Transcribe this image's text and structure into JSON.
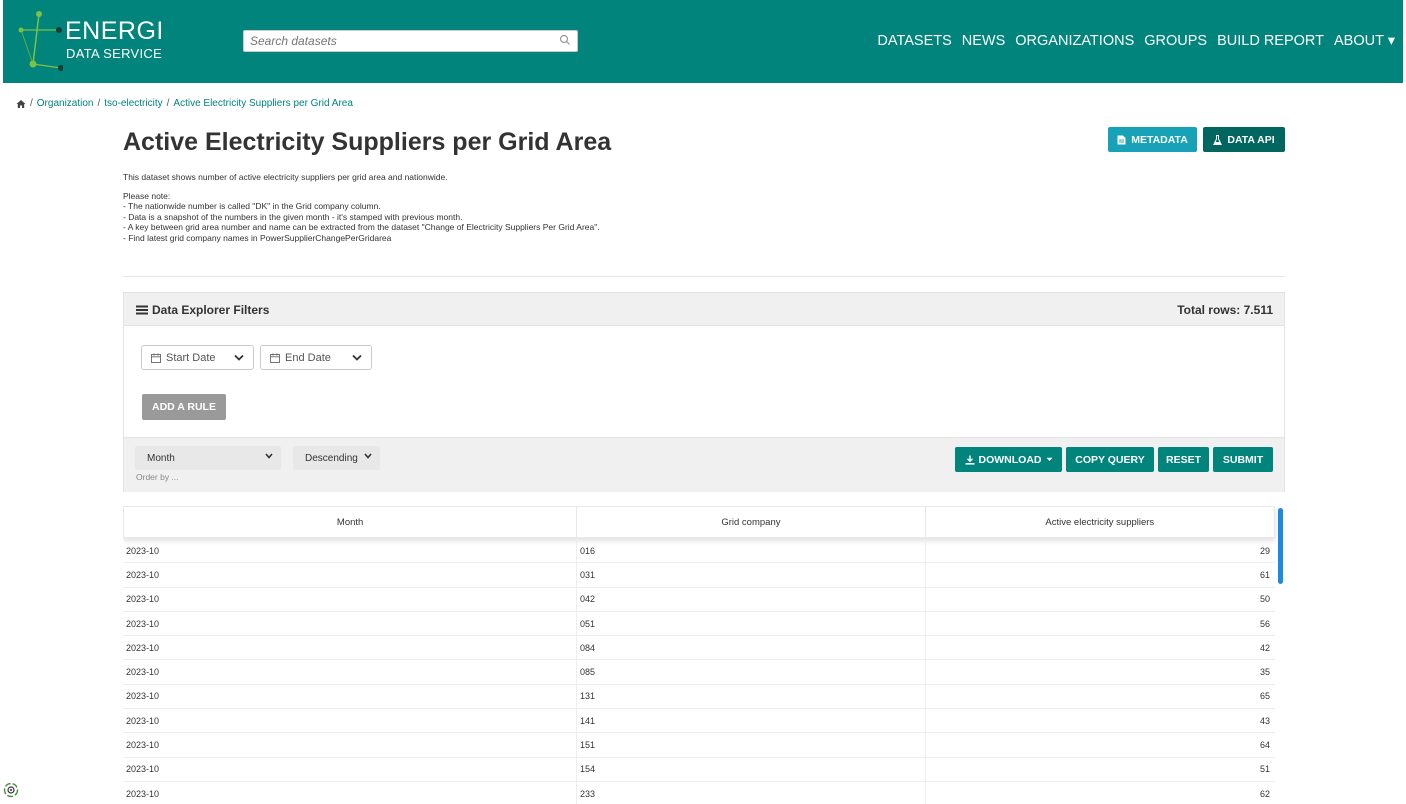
{
  "header": {
    "logo_text": "ENERGI",
    "logo_subtext": "DATA SERVICE",
    "search_placeholder": "Search datasets",
    "nav": [
      "DATASETS",
      "NEWS",
      "ORGANIZATIONS",
      "GROUPS",
      "BUILD REPORT",
      "ABOUT ▾"
    ]
  },
  "breadcrumb": {
    "items": [
      "Organization",
      "tso-electricity",
      "Active Electricity Suppliers per Grid Area"
    ],
    "separator": "/"
  },
  "page": {
    "title": "Active Electricity Suppliers per Grid Area",
    "metadata_label": "METADATA",
    "data_api_label": "DATA API",
    "description": {
      "intro": "This dataset shows number of active electricity suppliers per grid area and nationwide.",
      "note_heading": "Please note:",
      "notes": [
        "- The nationwide number is called \"DK\" in the Grid company column.",
        "- Data is a snapshot of the numbers in the given month - it's stamped with previous month.",
        "- A key between grid area number and name can be extracted from the dataset \"Change of Electricity Suppliers Per Grid Area\".",
        "- Find latest grid company names in PowerSupplierChangePerGridarea"
      ]
    }
  },
  "explorer": {
    "title": "Data Explorer Filters",
    "total_rows": "Total rows: 7.511",
    "start_date_label": "Start Date",
    "end_date_label": "End Date",
    "add_rule_label": "ADD A RULE",
    "order_field": "Month",
    "order_direction": "Descending",
    "order_by_hint": "Order by ...",
    "download_label": "DOWNLOAD",
    "copy_query_label": "COPY QUERY",
    "reset_label": "RESET",
    "submit_label": "SUBMIT"
  },
  "table": {
    "columns": [
      "Month",
      "Grid company",
      "Active electricity suppliers"
    ],
    "rows": [
      [
        "2023-10",
        "016",
        "29"
      ],
      [
        "2023-10",
        "031",
        "61"
      ],
      [
        "2023-10",
        "042",
        "50"
      ],
      [
        "2023-10",
        "051",
        "56"
      ],
      [
        "2023-10",
        "084",
        "42"
      ],
      [
        "2023-10",
        "085",
        "35"
      ],
      [
        "2023-10",
        "131",
        "65"
      ],
      [
        "2023-10",
        "141",
        "43"
      ],
      [
        "2023-10",
        "151",
        "64"
      ],
      [
        "2023-10",
        "154",
        "51"
      ],
      [
        "2023-10",
        "233",
        "62"
      ]
    ]
  },
  "colors": {
    "brand": "#00847c",
    "metadata_button": "#17a2b8",
    "data_api_button": "#00665f",
    "add_rule_button": "#9a9a9a",
    "scrollbar": "#1e88e5"
  },
  "icons": [
    "home-icon",
    "search-icon",
    "file-icon",
    "flask-icon",
    "list-icon",
    "calendar-icon",
    "chevron-down-icon",
    "download-icon",
    "caret-down-icon",
    "accessibility-icon"
  ]
}
